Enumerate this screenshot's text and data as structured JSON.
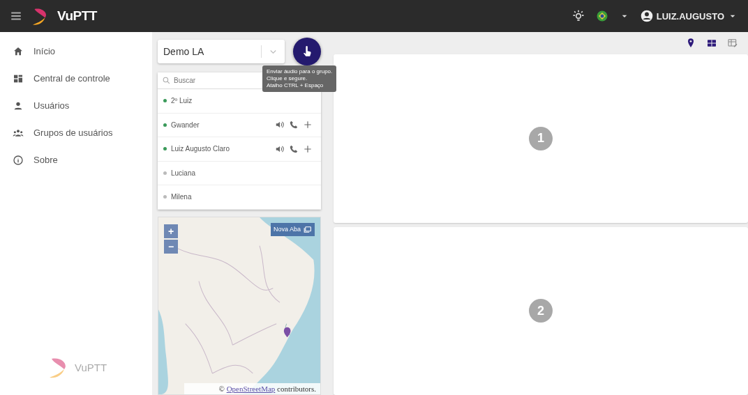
{
  "app_bar": {
    "brand": "VuPTT",
    "user": "LUIZ.AUGUSTO"
  },
  "sidebar": {
    "items": [
      {
        "label": "Início"
      },
      {
        "label": "Central de controle"
      },
      {
        "label": "Usuários"
      },
      {
        "label": "Grupos de usuários"
      },
      {
        "label": "Sobre"
      }
    ],
    "footer_brand": "VuPTT"
  },
  "group_select": {
    "value": "Demo LA"
  },
  "search": {
    "placeholder": "Buscar"
  },
  "tooltip": {
    "lines": [
      "Enviar áudio para o grupo.",
      "Clique e segure.",
      "Atalho CTRL + Espaço"
    ]
  },
  "users": [
    {
      "name": "2º Luiz",
      "online": true,
      "actions": false
    },
    {
      "name": "Gwander",
      "online": true,
      "actions": true
    },
    {
      "name": "Luiz Augusto Claro",
      "online": true,
      "actions": true
    },
    {
      "name": "Luciana",
      "online": false,
      "actions": false
    },
    {
      "name": "Milena",
      "online": false,
      "actions": false
    }
  ],
  "map": {
    "zoom_in": "+",
    "zoom_out": "−",
    "new_tab": "Nova Aba",
    "attribution_prefix": "©",
    "attribution_link": "OpenStreetMap",
    "attribution_suffix": "contributors."
  },
  "panels": [
    {
      "number": "1"
    },
    {
      "number": "2"
    }
  ]
}
